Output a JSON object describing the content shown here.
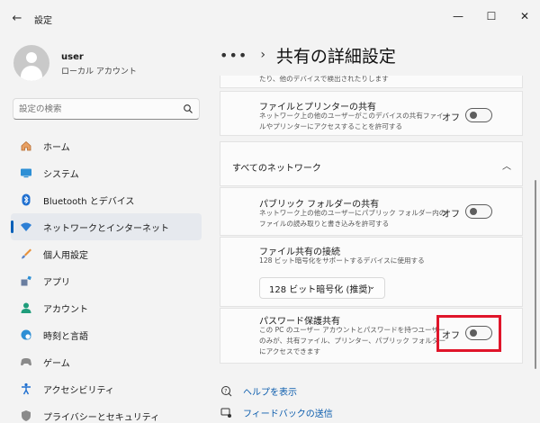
{
  "window": {
    "back": "←",
    "title": "設定",
    "minimize": "—",
    "maximize": "☐",
    "close": "✕"
  },
  "user": {
    "name": "user",
    "account_type": "ローカル アカウント"
  },
  "search": {
    "placeholder": "設定の検索"
  },
  "nav": {
    "items": [
      {
        "label": "ホーム",
        "icon": "home-icon"
      },
      {
        "label": "システム",
        "icon": "system-icon"
      },
      {
        "label": "Bluetooth とデバイス",
        "icon": "bluetooth-icon"
      },
      {
        "label": "ネットワークとインターネット",
        "icon": "wifi-icon",
        "active": true
      },
      {
        "label": "個人用設定",
        "icon": "brush-icon"
      },
      {
        "label": "アプリ",
        "icon": "apps-icon"
      },
      {
        "label": "アカウント",
        "icon": "account-icon"
      },
      {
        "label": "時刻と言語",
        "icon": "globe-icon"
      },
      {
        "label": "ゲーム",
        "icon": "gamepad-icon"
      },
      {
        "label": "アクセシビリティ",
        "icon": "accessibility-icon"
      },
      {
        "label": "プライバシーとセキュリティ",
        "icon": "shield-icon"
      }
    ]
  },
  "header": {
    "dots": "•••",
    "chevron": "›",
    "title": "共有の詳細設定"
  },
  "settings": {
    "top_partial_desc": "たり、他のデバイスで検出されたりします",
    "file_printer": {
      "title": "ファイルとプリンターの共有",
      "desc_line1": "ネットワーク上の他のユーザーがこのデバイスの共有ファイ",
      "desc_line2": "ルやプリンターにアクセスすることを許可する",
      "toggle_label": "オフ"
    },
    "all_networks": {
      "label": "すべてのネットワーク",
      "chevron": "︿"
    },
    "public_folder": {
      "title": "パブリック フォルダーの共有",
      "desc_line1": "ネットワーク上の他のユーザーにパブリック フォルダー内の",
      "desc_line2": "ファイルの読み取りと書き込みを許可する",
      "toggle_label": "オフ"
    },
    "file_connection": {
      "title": "ファイル共有の接続",
      "desc": "128 ビット暗号化をサポートするデバイスに使用する",
      "select_value": "128 ビット暗号化 (推奨)",
      "select_arrow": "⌄"
    },
    "password": {
      "title": "パスワード保護共有",
      "desc_line1": "この PC のユーザー アカウントとパスワードを持つユーザー",
      "desc_line2": "のみが、共有ファイル、プリンター、パブリック フォルダー",
      "desc_line3": "にアクセスできます",
      "toggle_label": "オフ"
    }
  },
  "footer": {
    "help": "ヘルプを表示",
    "feedback": "フィードバックの送信"
  },
  "colors": {
    "accent": "#005fb8",
    "highlight": "#e0152a"
  }
}
